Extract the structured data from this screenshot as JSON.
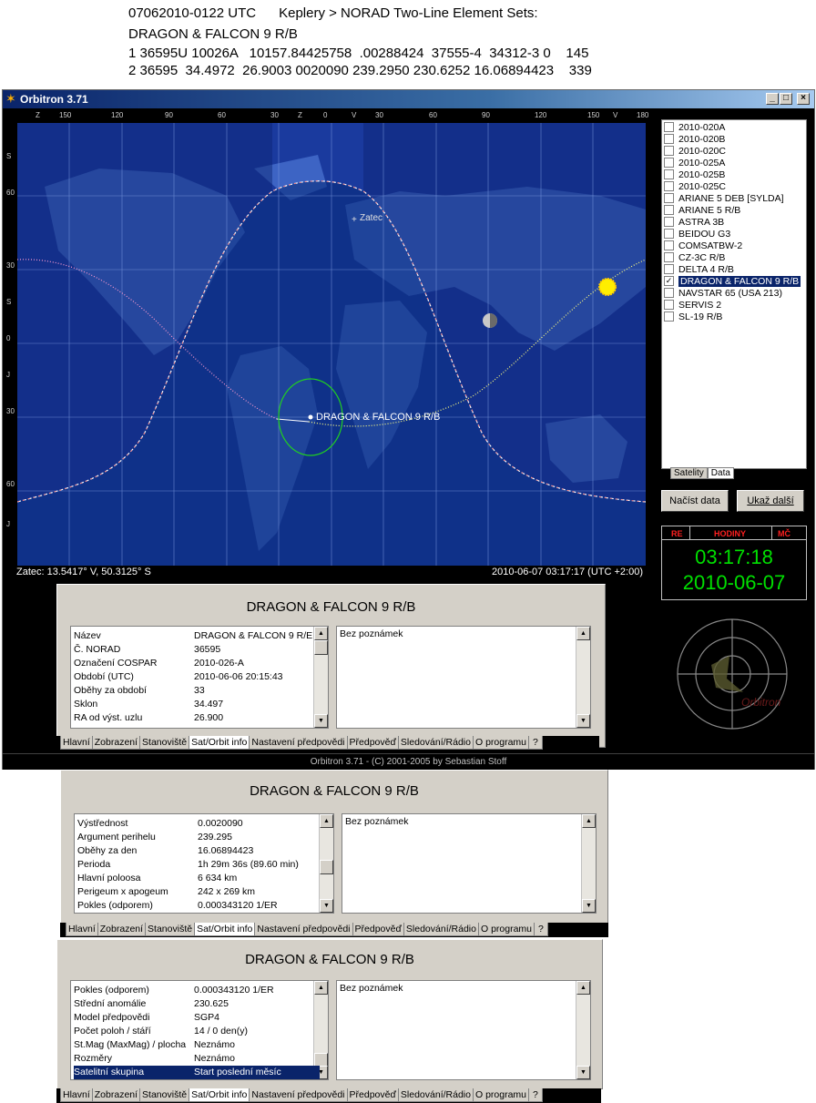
{
  "header": {
    "line1": "07062010-0122 UTC      Keplery > NORAD Two-Line Element Sets:",
    "line2": "DRAGON & FALCON 9 R/B",
    "line3": "1 36595U 10026A   10157.84425758  .00288424  37555-4  34312-3 0    145",
    "line4": "2 36595  34.4972  26.9003 0020090 239.2950 230.6252 16.06894423    339"
  },
  "window": {
    "title": "Orbitron 3.71",
    "min": "_",
    "max": "□",
    "close": "×",
    "status": "Orbitron 3.71 - (C) 2001-2005 by Sebastian Stoff"
  },
  "map": {
    "top_scale": [
      "Z",
      "150",
      "120",
      "90",
      "60",
      "30",
      "Z",
      "0",
      "V",
      "30",
      "60",
      "90",
      "120",
      "150",
      "V",
      "180"
    ],
    "left_scale": [
      "S",
      "60",
      "30",
      "S",
      "0",
      "J",
      "30",
      "60",
      "J"
    ],
    "location_label": "Zatec",
    "sat_label": "DRAGON & FALCON 9 R/B",
    "coords": "Zatec: 13.5417° V, 50.3125° S",
    "datetime": "2010-06-07 03:17:17 (UTC +2:00)"
  },
  "satellites": [
    {
      "name": "2010-020A",
      "checked": false
    },
    {
      "name": "2010-020B",
      "checked": false
    },
    {
      "name": "2010-020C",
      "checked": false
    },
    {
      "name": "2010-025A",
      "checked": false
    },
    {
      "name": "2010-025B",
      "checked": false
    },
    {
      "name": "2010-025C",
      "checked": false
    },
    {
      "name": "ARIANE 5 DEB [SYLDA]",
      "checked": false
    },
    {
      "name": "ARIANE 5 R/B",
      "checked": false
    },
    {
      "name": "ASTRA 3B",
      "checked": false
    },
    {
      "name": "BEIDOU G3",
      "checked": false
    },
    {
      "name": "COMSATBW-2",
      "checked": false
    },
    {
      "name": "CZ-3C R/B",
      "checked": false
    },
    {
      "name": "DELTA 4 R/B",
      "checked": false
    },
    {
      "name": "DRAGON & FALCON 9 R/B",
      "checked": true,
      "selected": true
    },
    {
      "name": "NAVSTAR 65 (USA 213)",
      "checked": false
    },
    {
      "name": "SERVIS 2",
      "checked": false
    },
    {
      "name": "SL-19 R/B",
      "checked": false
    }
  ],
  "right_tabs": [
    "Satelity",
    "Data"
  ],
  "buttons": {
    "load": "Načíst data",
    "show": "Ukaž další"
  },
  "clock": {
    "re": "RE",
    "hodiny": "HODINY",
    "mc": "MČ",
    "time": "03:17:18",
    "date": "2010-06-07"
  },
  "radar_logo": "Orbitron",
  "check_mark": "✓",
  "tabs": [
    "Hlavní",
    "Zobrazení",
    "Stanoviště",
    "Sat/Orbit info",
    "Nastavení předpovědi",
    "Předpověď",
    "Sledování/Rádio",
    "O programu",
    "?"
  ],
  "panel1": {
    "title": "DRAGON & FALCON 9 R/B",
    "rows": [
      [
        "Název",
        "DRAGON & FALCON 9 R/E"
      ],
      [
        "Č. NORAD",
        "36595"
      ],
      [
        "Označení COSPAR",
        "2010-026-A"
      ],
      [
        "Období (UTC)",
        "2010-06-06 20:15:43"
      ],
      [
        "Oběhy za období",
        "33"
      ],
      [
        "Sklon",
        "34.497"
      ],
      [
        "RA od výst. uzlu",
        "26.900"
      ]
    ],
    "note": "Bez poznámek"
  },
  "panel2": {
    "title": "DRAGON & FALCON 9 R/B",
    "rows": [
      [
        "Výstřednost",
        "0.0020090"
      ],
      [
        "Argument perihelu",
        "239.295"
      ],
      [
        "Oběhy za den",
        "16.06894423"
      ],
      [
        "Perioda",
        "1h 29m 36s (89.60 min)"
      ],
      [
        "Hlavní poloosa",
        "6 634 km"
      ],
      [
        "Perigeum x apogeum",
        "242 x 269 km"
      ],
      [
        "Pokles (odporem)",
        "0.000343120 1/ER"
      ]
    ],
    "note": "Bez poznámek"
  },
  "panel3": {
    "title": "DRAGON & FALCON 9 R/B",
    "rows": [
      [
        "Pokles (odporem)",
        "0.000343120 1/ER"
      ],
      [
        "Střední anomálie",
        "230.625"
      ],
      [
        "Model předpovědi",
        "SGP4"
      ],
      [
        "Počet poloh / stáří",
        "14 / 0 den(y)"
      ],
      [
        "St.Mag (MaxMag) / plocha",
        "Neznámo"
      ],
      [
        "Rozměry",
        "Neznámo"
      ],
      [
        "Satelitní skupina",
        "Start poslední měsíc"
      ]
    ],
    "note": "Bez poznámek"
  }
}
